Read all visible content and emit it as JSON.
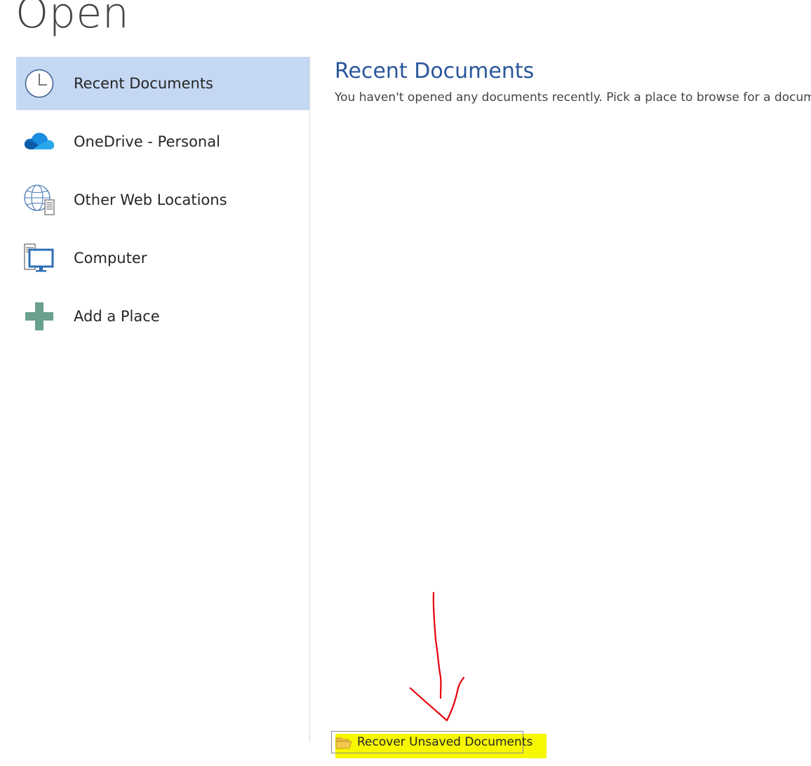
{
  "page": {
    "title": "Open"
  },
  "places": [
    {
      "label": "Recent Documents",
      "icon": "clock-icon",
      "selected": true
    },
    {
      "label": "OneDrive - Personal",
      "icon": "onedrive-cloud-icon",
      "selected": false
    },
    {
      "label": "Other Web Locations",
      "icon": "globe-server-icon",
      "selected": false
    },
    {
      "label": "Computer",
      "icon": "computer-icon",
      "selected": false
    },
    {
      "label": "Add a Place",
      "icon": "plus-icon",
      "selected": false
    }
  ],
  "main": {
    "heading": "Recent Documents",
    "message": "You haven't opened any documents recently. Pick a place to browse for a document."
  },
  "recover": {
    "label": "Recover Unsaved Documents",
    "icon": "folder-open-icon"
  },
  "annotation": {
    "arrow_color": "#e8000b",
    "highlight_color": "#f7f700"
  },
  "colors": {
    "accent": "#2b579a",
    "selected_bg": "#c5d8f3"
  }
}
